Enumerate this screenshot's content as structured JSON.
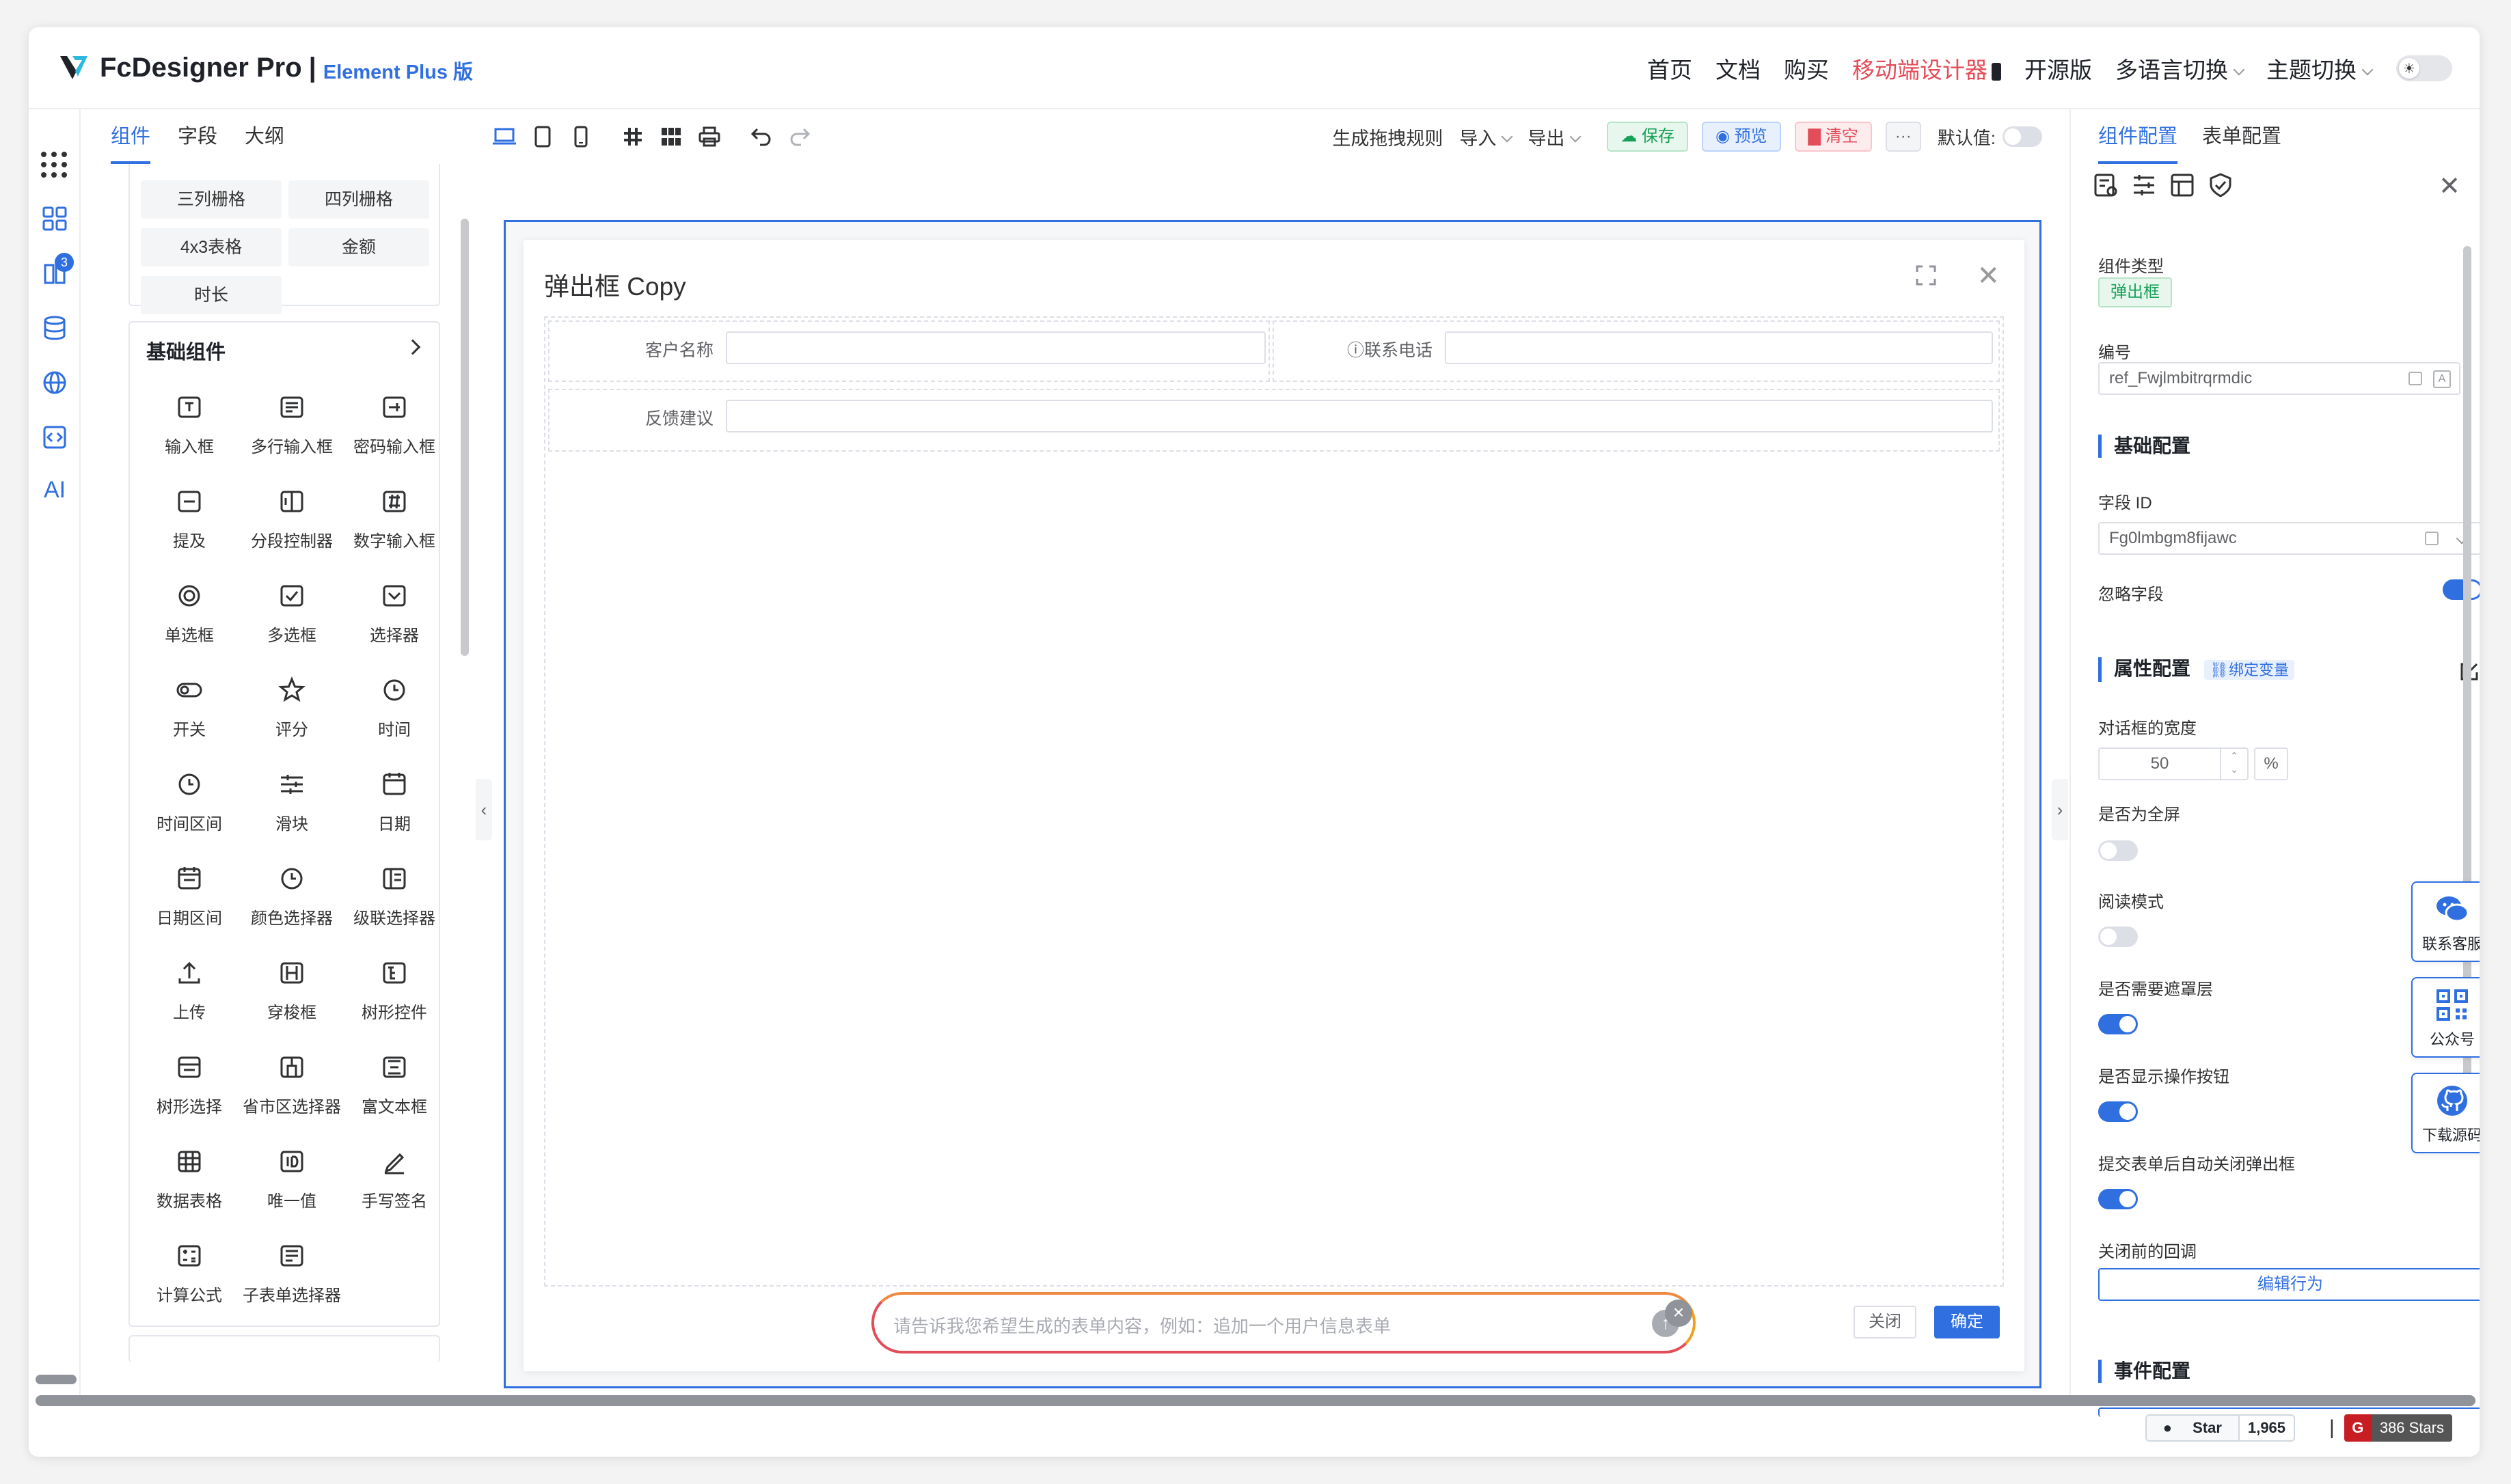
{
  "header": {
    "logo_name": "FcDesigner Pro",
    "logo_sep": "|",
    "logo_sub": "Element Plus 版",
    "nav": [
      "首页",
      "文档",
      "购买"
    ],
    "nav_mobile": "移动端设计器",
    "nav_more": [
      "开源版"
    ],
    "lang": "多语言切换",
    "theme": "主题切换"
  },
  "rail": {
    "badge": "3",
    "ai": "AI"
  },
  "left_panel": {
    "tabs": [
      "组件",
      "字段",
      "大纲"
    ],
    "layout_chips": [
      "三列栅格",
      "四列栅格",
      "4x3表格",
      "金额",
      "时长"
    ],
    "basic_title": "基础组件",
    "components": [
      "输入框",
      "多行输入框",
      "密码输入框",
      "提及",
      "分段控制器",
      "数字输入框",
      "单选框",
      "多选框",
      "选择器",
      "开关",
      "评分",
      "时间",
      "时间区间",
      "滑块",
      "日期",
      "日期区间",
      "颜色选择器",
      "级联选择器",
      "上传",
      "穿梭框",
      "树形控件",
      "树形选择",
      "省市区选择器",
      "富文本框",
      "数据表格",
      "唯一值",
      "手写签名",
      "计算公式",
      "子表单选择器"
    ]
  },
  "toolbar": {
    "rules": "生成拖拽规则",
    "import": "导入",
    "export": "导出",
    "save": "保存",
    "preview": "预览",
    "clear": "清空",
    "more": "···",
    "default_value": "默认值:"
  },
  "dialog": {
    "title": "弹出框 Copy",
    "fields": [
      {
        "label": "客户名称"
      },
      {
        "label": "ⓘ联系电话"
      },
      {
        "label": "反馈建议"
      }
    ],
    "cancel": "关闭",
    "confirm": "确定",
    "ai_placeholder": "请告诉我您希望生成的表单内容，例如：追加一个用户信息表单"
  },
  "right_panel": {
    "tabs": [
      "组件配置",
      "表单配置"
    ],
    "comp_type_label": "组件类型",
    "comp_type_value": "弹出框",
    "ref_label": "编号",
    "ref_value": "ref_Fwjlmbitrqrmdic",
    "base_section": "基础配置",
    "field_id_label": "字段 ID",
    "field_id_value": "Fg0lmbgm8fijawc",
    "ignore_label": "忽略字段",
    "attr_section": "属性配置",
    "bind_var": "绑定变量",
    "width_label": "对话框的宽度",
    "width_value": "50",
    "width_unit": "%",
    "fullscreen_label": "是否为全屏",
    "readonly_label": "阅读模式",
    "mask_label": "是否需要遮罩层",
    "show_btn_label": "是否显示操作按钮",
    "auto_close_label": "提交表单后自动关闭弹出框",
    "before_close_label": "关闭前的回调",
    "edit_behavior": "编辑行为",
    "event_section": "事件配置"
  },
  "floats": [
    "联系客服",
    "公众号",
    "下载源码"
  ],
  "footer": {
    "star": "Star",
    "star_count": "1,965",
    "pipe": "|",
    "gitee_logo": "G",
    "gitee_stars": "386 Stars"
  },
  "colors": {
    "primary": "#2f6fe0",
    "danger": "#e34d59",
    "success": "#18a058"
  }
}
